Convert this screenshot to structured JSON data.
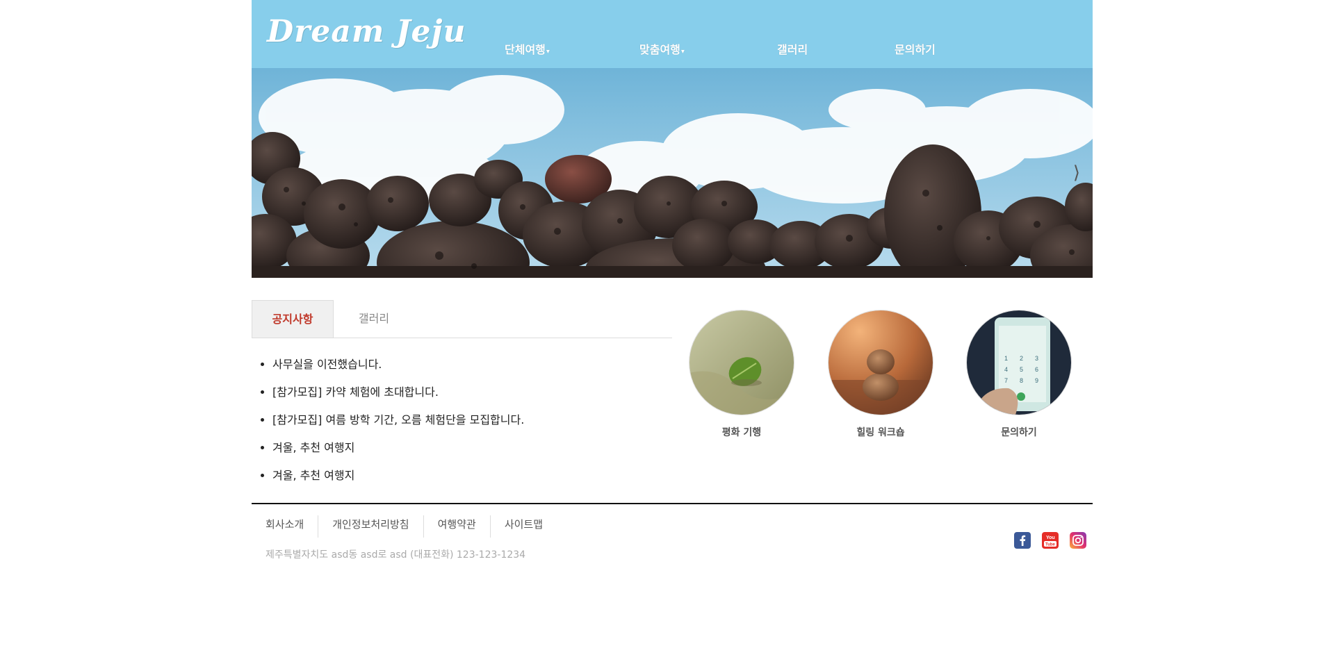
{
  "header": {
    "logo": "Dream Jeju",
    "nav": [
      {
        "label": "단체여행",
        "caret": "▾"
      },
      {
        "label": "맞춤여행",
        "caret": "▾"
      },
      {
        "label": "갤러리",
        "caret": ""
      },
      {
        "label": "문의하기",
        "caret": ""
      }
    ],
    "accent_color": "#87ceeb"
  },
  "hero": {
    "next_glyph": "⟩",
    "icon": "chevron-right-icon"
  },
  "tabs": [
    {
      "label": "공지사항",
      "active": true
    },
    {
      "label": "갤러리",
      "active": false
    }
  ],
  "notices": [
    "사무실을 이전했습니다.",
    "[참가모집] 카약 체험에 초대합니다.",
    "[참가모집] 여름 방학 기간, 오름 체험단을 모집합니다.",
    "겨울, 추천 여행지",
    "겨울, 추천 여행지"
  ],
  "cards": [
    {
      "caption": "평화 기행",
      "icon": "leaf-on-sand-image"
    },
    {
      "caption": "힐링 워크숍",
      "icon": "stacked-stones-image"
    },
    {
      "caption": "문의하기",
      "icon": "phone-dialer-image"
    }
  ],
  "footer": {
    "links": [
      "회사소개",
      "개인정보처리방침",
      "여행약관",
      "사이트맵"
    ],
    "address": "제주특별자치도 asd동 asd로 asd (대표전화) 123-123-1234",
    "social": [
      {
        "name": "facebook-icon",
        "color": "#3b5998"
      },
      {
        "name": "youtube-icon",
        "color": "#e52d27"
      },
      {
        "name": "instagram-icon",
        "color": "#d6249f"
      }
    ]
  }
}
